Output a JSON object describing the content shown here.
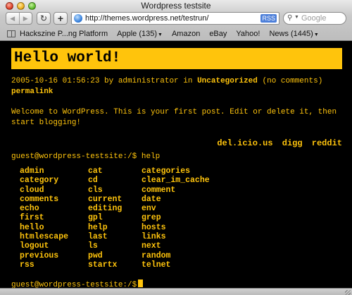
{
  "window": {
    "title": "Wordpress testsite"
  },
  "toolbar": {
    "back_icon": "back-arrow-icon",
    "forward_icon": "forward-arrow-icon",
    "url": "http://themes.wordpress.net/testrun/",
    "rss_label": "RSS",
    "search_placeholder": "Google"
  },
  "bookmarks": [
    {
      "label": "Hackszine P...ng Platform",
      "has_menu": false
    },
    {
      "label": "Apple (135)",
      "has_menu": true
    },
    {
      "label": "Amazon",
      "has_menu": false
    },
    {
      "label": "eBay",
      "has_menu": false
    },
    {
      "label": "Yahoo!",
      "has_menu": false
    },
    {
      "label": "News (1445)",
      "has_menu": true
    }
  ],
  "post": {
    "title": "Hello world!",
    "date": "2005-10-16 01:56:23",
    "by_text": "by administrator in",
    "category": "Uncategorized",
    "comments": "(no comments)",
    "permalink": "permalink",
    "body": "Welcome to WordPress. This is your first post. Edit or delete it, then start blogging!",
    "social": [
      "del.icio.us",
      "digg",
      "reddit"
    ]
  },
  "terminal": {
    "prompt": "guest@wordpress-testsite:/$",
    "command": "help",
    "commands": [
      [
        "admin",
        "cat",
        "categories"
      ],
      [
        "category",
        "cd",
        "clear_im_cache"
      ],
      [
        "cloud",
        "cls",
        "comment"
      ],
      [
        "comments",
        "current",
        "date"
      ],
      [
        "echo",
        "editing",
        "env"
      ],
      [
        "first",
        "gpl",
        "grep"
      ],
      [
        "hello",
        "help",
        "hosts"
      ],
      [
        "htmlescape",
        "last",
        "links"
      ],
      [
        "logout",
        "ls",
        "next"
      ],
      [
        "previous",
        "pwd",
        "random"
      ],
      [
        "rss",
        "startx",
        "telnet"
      ]
    ]
  },
  "colors": {
    "accent": "#ffc40c",
    "background": "#000000"
  }
}
